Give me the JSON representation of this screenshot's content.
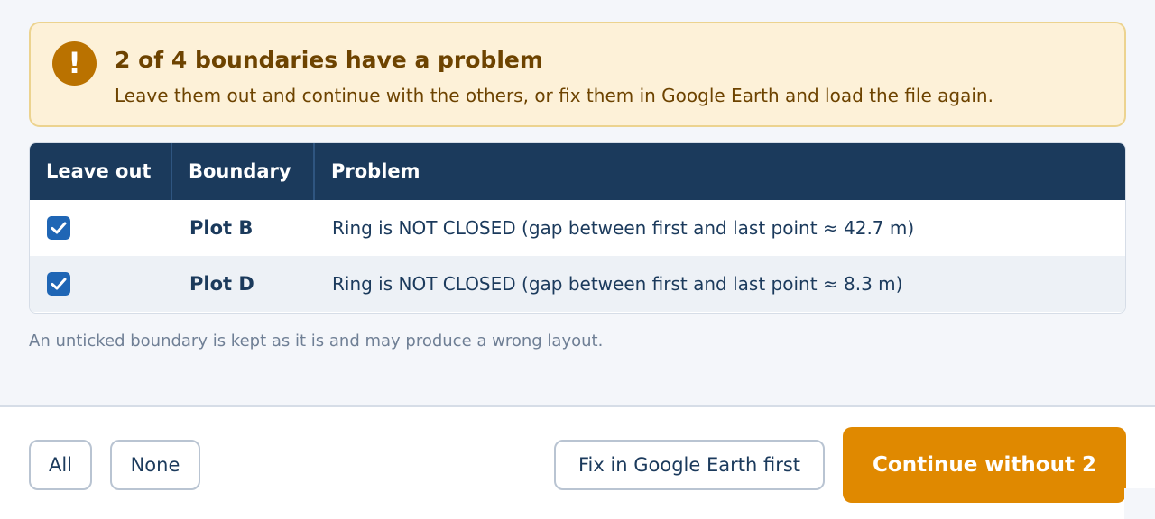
{
  "banner": {
    "icon": "exclamation-icon",
    "title": "2 of 4 boundaries have a problem",
    "text": "Leave them out and continue with the others, or fix them in Google Earth and load the file again."
  },
  "table": {
    "headers": [
      "Leave out",
      "Boundary",
      "Problem"
    ],
    "rows": [
      {
        "checked": true,
        "name": "Plot B",
        "problem": "Ring is NOT CLOSED  (gap between first and last point ≈ 42.7 m)"
      },
      {
        "checked": true,
        "name": "Plot D",
        "problem": "Ring is NOT CLOSED  (gap between first and last point ≈ 8.3 m)"
      }
    ]
  },
  "note": "An unticked boundary is kept as it is and may produce a wrong layout.",
  "footer": {
    "all_label": "All",
    "none_label": "None",
    "fix_label": "Fix in Google Earth first",
    "continue_label": "Continue without 2"
  },
  "colors": {
    "navy": "#1b3a5c",
    "accent": "#e08900",
    "warning_bg": "#fdf1d8",
    "warning_icon": "#ba7200",
    "checkbox": "#1f66b5"
  }
}
